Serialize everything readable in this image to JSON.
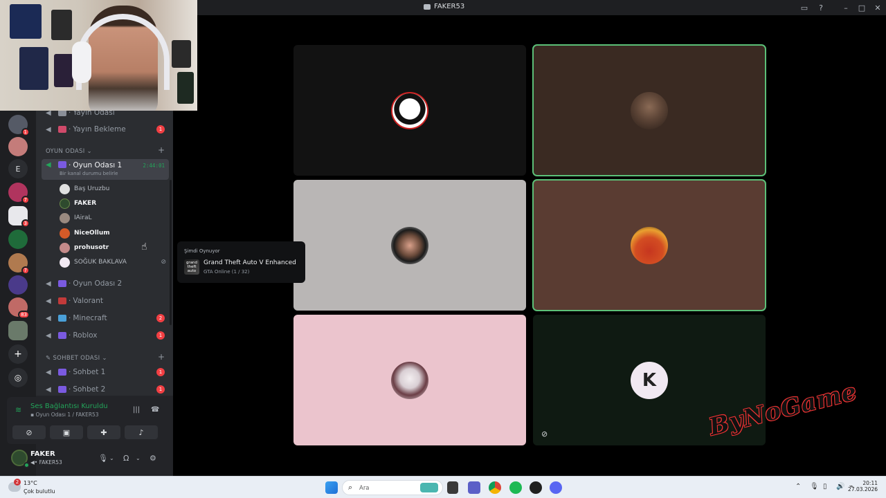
{
  "window": {
    "title": "FAKER53"
  },
  "sidebar": {
    "channels_top": [
      {
        "name": "Yayın Odası"
      },
      {
        "name": "Yayın Bekleme",
        "badge": "1"
      }
    ],
    "category_game": "OYUN ODASI",
    "active_channel": {
      "name": "Oyun Odası 1",
      "timer": "2:44:01",
      "status": "Bir kanal durumu belirle"
    },
    "users": [
      {
        "name": "Baş Uruzbu"
      },
      {
        "name": "FAKER"
      },
      {
        "name": "IAiraL"
      },
      {
        "name": "NiceOllum"
      },
      {
        "name": "prohusotr"
      },
      {
        "name": "SOĞUK BAKLAVA"
      }
    ],
    "channels_game": [
      {
        "name": "Oyun Odası 2"
      },
      {
        "name": "Valorant"
      },
      {
        "name": "Minecraft",
        "badge": "2"
      },
      {
        "name": "Roblox",
        "badge": "1"
      }
    ],
    "category_chat": "SOHBET ODASI",
    "channels_chat": [
      {
        "name": "Sohbet 1",
        "badge": "1"
      },
      {
        "name": "Sohbet 2",
        "badge": "1"
      }
    ]
  },
  "rail": {
    "letter_server": "E",
    "badges": [
      "1",
      "7",
      "3",
      "7",
      "83"
    ]
  },
  "voice_panel": {
    "title": "Ses Bağlantısı Kuruldu",
    "subtitle": "Oyun Odası 1 / FAKER53"
  },
  "user_panel": {
    "name": "FAKER",
    "tag": "FAKER53"
  },
  "tooltip": {
    "label": "Şimdi Oynuyor",
    "game": "Grand Theft Auto V Enhanced",
    "sub": "GTA Online (1 / 32)",
    "logo_text": "grand theft auto"
  },
  "stage": {
    "tiles": [
      {
        "name": "tile-1",
        "color": "#121212",
        "speaking": false
      },
      {
        "name": "tile-2",
        "color": "#3a2a22",
        "speaking": true
      },
      {
        "name": "tile-3",
        "color": "#b9b6b5",
        "speaking": false
      },
      {
        "name": "tile-4",
        "color": "#5a3c32",
        "speaking": true
      },
      {
        "name": "tile-5",
        "color": "#ebc4cd",
        "speaking": false
      },
      {
        "name": "tile-6",
        "color": "#0f1a12",
        "speaking": false
      }
    ]
  },
  "watermark": "ByNoGame",
  "taskbar": {
    "temp": "13°C",
    "weather": "Çok bulutlu",
    "weather_badge": "2",
    "search": "Ara",
    "time": "20:11",
    "date": "27.03.2026"
  },
  "colors": {
    "accent_green": "#23a55a",
    "badge_red": "#f23f43"
  }
}
